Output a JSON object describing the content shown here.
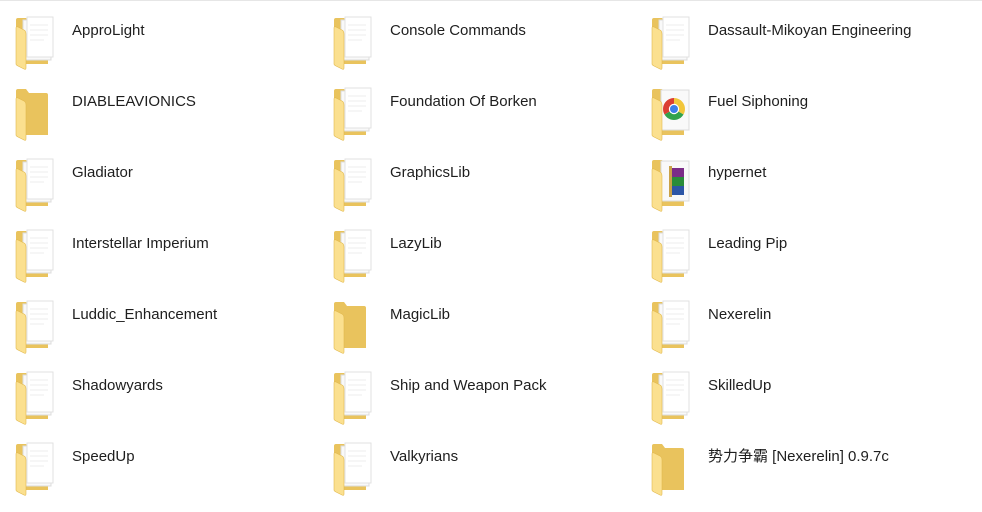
{
  "folders": [
    {
      "name": "ApproLight",
      "icon": "folder-with-documents-icon"
    },
    {
      "name": "Console Commands",
      "icon": "folder-with-documents-icon"
    },
    {
      "name": "Dassault-Mikoyan Engineering",
      "icon": "folder-with-documents-icon"
    },
    {
      "name": "DIABLEAVIONICS",
      "icon": "folder-empty-icon"
    },
    {
      "name": "Foundation Of Borken",
      "icon": "folder-with-documents-icon"
    },
    {
      "name": "Fuel Siphoning",
      "icon": "folder-chrome-icon"
    },
    {
      "name": "Gladiator",
      "icon": "folder-with-documents-icon"
    },
    {
      "name": "GraphicsLib",
      "icon": "folder-with-documents-icon"
    },
    {
      "name": "hypernet",
      "icon": "folder-winrar-icon"
    },
    {
      "name": "Interstellar Imperium",
      "icon": "folder-with-documents-icon"
    },
    {
      "name": "LazyLib",
      "icon": "folder-with-documents-icon"
    },
    {
      "name": "Leading Pip",
      "icon": "folder-with-documents-icon"
    },
    {
      "name": "Luddic_Enhancement",
      "icon": "folder-with-documents-icon"
    },
    {
      "name": "MagicLib",
      "icon": "folder-empty-icon"
    },
    {
      "name": "Nexerelin",
      "icon": "folder-with-documents-icon"
    },
    {
      "name": "Shadowyards",
      "icon": "folder-with-documents-icon"
    },
    {
      "name": "Ship and Weapon Pack",
      "icon": "folder-with-documents-icon"
    },
    {
      "name": "SkilledUp",
      "icon": "folder-with-documents-icon"
    },
    {
      "name": "SpeedUp",
      "icon": "folder-with-documents-icon"
    },
    {
      "name": "Valkyrians",
      "icon": "folder-with-documents-icon"
    },
    {
      "name": "势力争霸 [Nexerelin] 0.9.7c",
      "icon": "folder-empty-icon"
    }
  ],
  "colors": {
    "folder_back": "#e9c35d",
    "folder_front": "#fbe08f",
    "folder_edge": "#e2b94e",
    "paper": "#f9f9f9",
    "label": "#1e1e1e"
  }
}
